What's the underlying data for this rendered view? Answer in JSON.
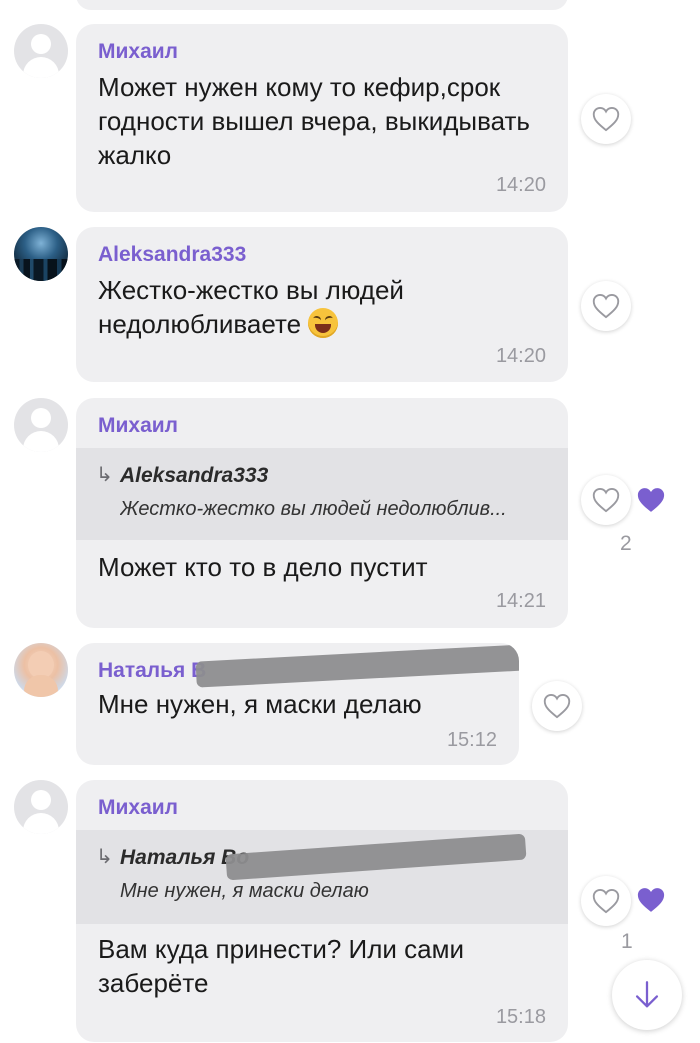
{
  "accent_color": "#7a5fcf",
  "messages": [
    {
      "author": "Михаил",
      "avatar": "default-avatar",
      "text": "Может нужен кому то кефир,срок годности вышел вчера, выкидывать жалко",
      "time": "14:20"
    },
    {
      "author": "Aleksandra333",
      "avatar": "photo-avatar",
      "text": "Жестко-жестко вы людей недолюбливаете",
      "emoji": "grinning-squinting-face",
      "time": "14:20"
    },
    {
      "author": "Михаил",
      "avatar": "default-avatar",
      "quote": {
        "author": "Aleksandra333",
        "text": "Жестко-жестко вы людей недолюблив..."
      },
      "text": "Может кто то в дело пустит",
      "time": "14:21",
      "likes": "2"
    },
    {
      "author": "Наталья В",
      "avatar": "photo-avatar",
      "text": "Мне нужен, я маски делаю",
      "time": "15:12"
    },
    {
      "author": "Михаил",
      "avatar": "default-avatar",
      "quote": {
        "author": "Наталья Во",
        "text": "Мне нужен, я маски делаю"
      },
      "text": "Вам куда принести? Или сами заберёте",
      "time": "15:18",
      "likes": "1"
    }
  ],
  "icons": {
    "like": "heart-outline-icon",
    "liked": "heart-filled-icon",
    "reply": "reply-arrow-icon",
    "scroll": "arrow-down-icon"
  },
  "quote_arrow": "↳"
}
